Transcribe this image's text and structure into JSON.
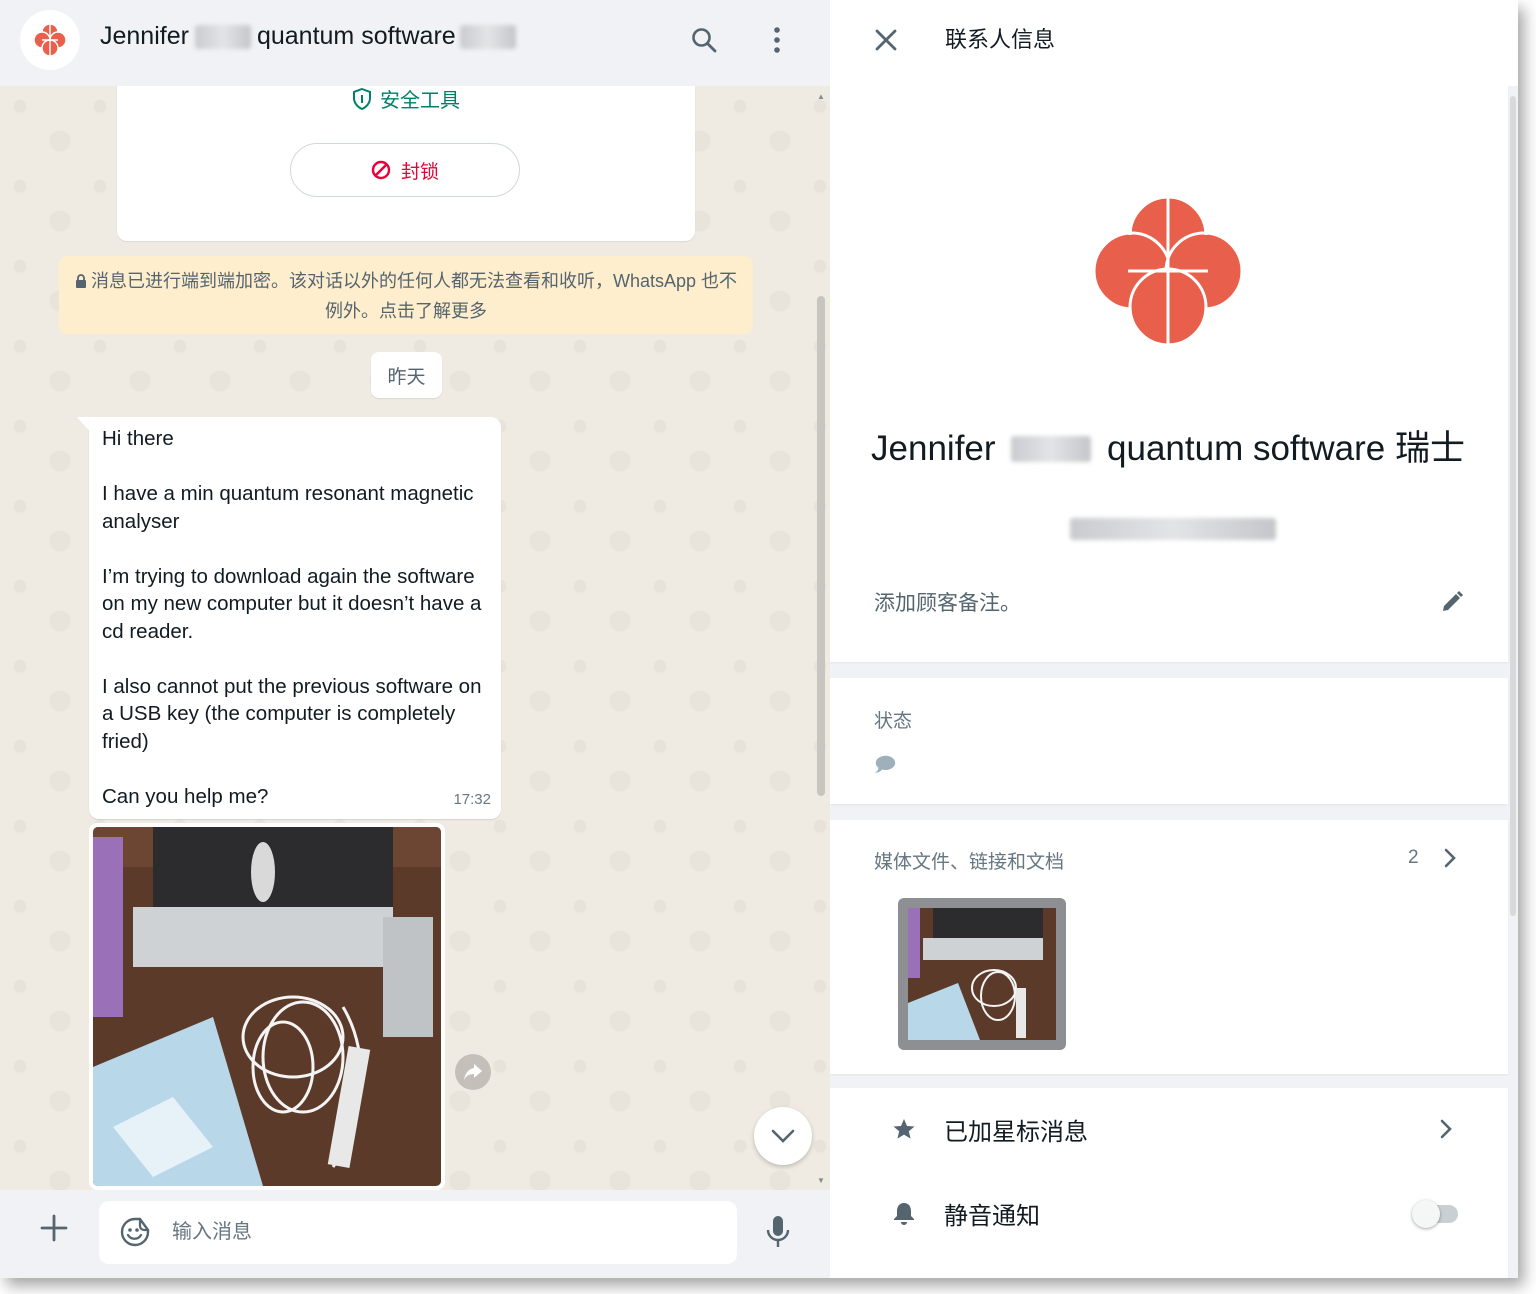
{
  "chat": {
    "contact_name_start": "Jennifer",
    "contact_name_mid": "quantum software",
    "safety_tools_label": "安全工具",
    "block_label": "封锁",
    "encryption_notice": "消息已进行端到端加密。该对话以外的任何人都无法查看和收听，WhatsApp 也不例外。点击了解更多",
    "date_chip": "昨天",
    "message": {
      "paragraphs": [
        "Hi there",
        "I have a min quantum resonant magnetic analyser",
        "I’m trying to download again the software on my new computer but it doesn’t have a cd reader.",
        "I also cannot put the previous software on a USB key (the computer is completely fried)",
        "Can you help me?"
      ],
      "time": "17:32"
    },
    "composer_placeholder": "输入消息"
  },
  "info": {
    "title": "联系人信息",
    "name_start": "Jennifer",
    "name_end": "quantum software 瑞士",
    "add_note": "添加顾客备注。",
    "status_label": "状态",
    "status_value": "🗩",
    "media_label": "媒体文件、链接和文档",
    "media_count": "2",
    "starred_label": "已加星标消息",
    "mute_label": "静音通知",
    "mute_on": false
  },
  "colors": {
    "brand_avatar": "#e8604c",
    "accent_green": "#008069",
    "block_red": "#ea0038",
    "notice_bg": "#ffeecd",
    "chat_bg": "#efeae2"
  }
}
